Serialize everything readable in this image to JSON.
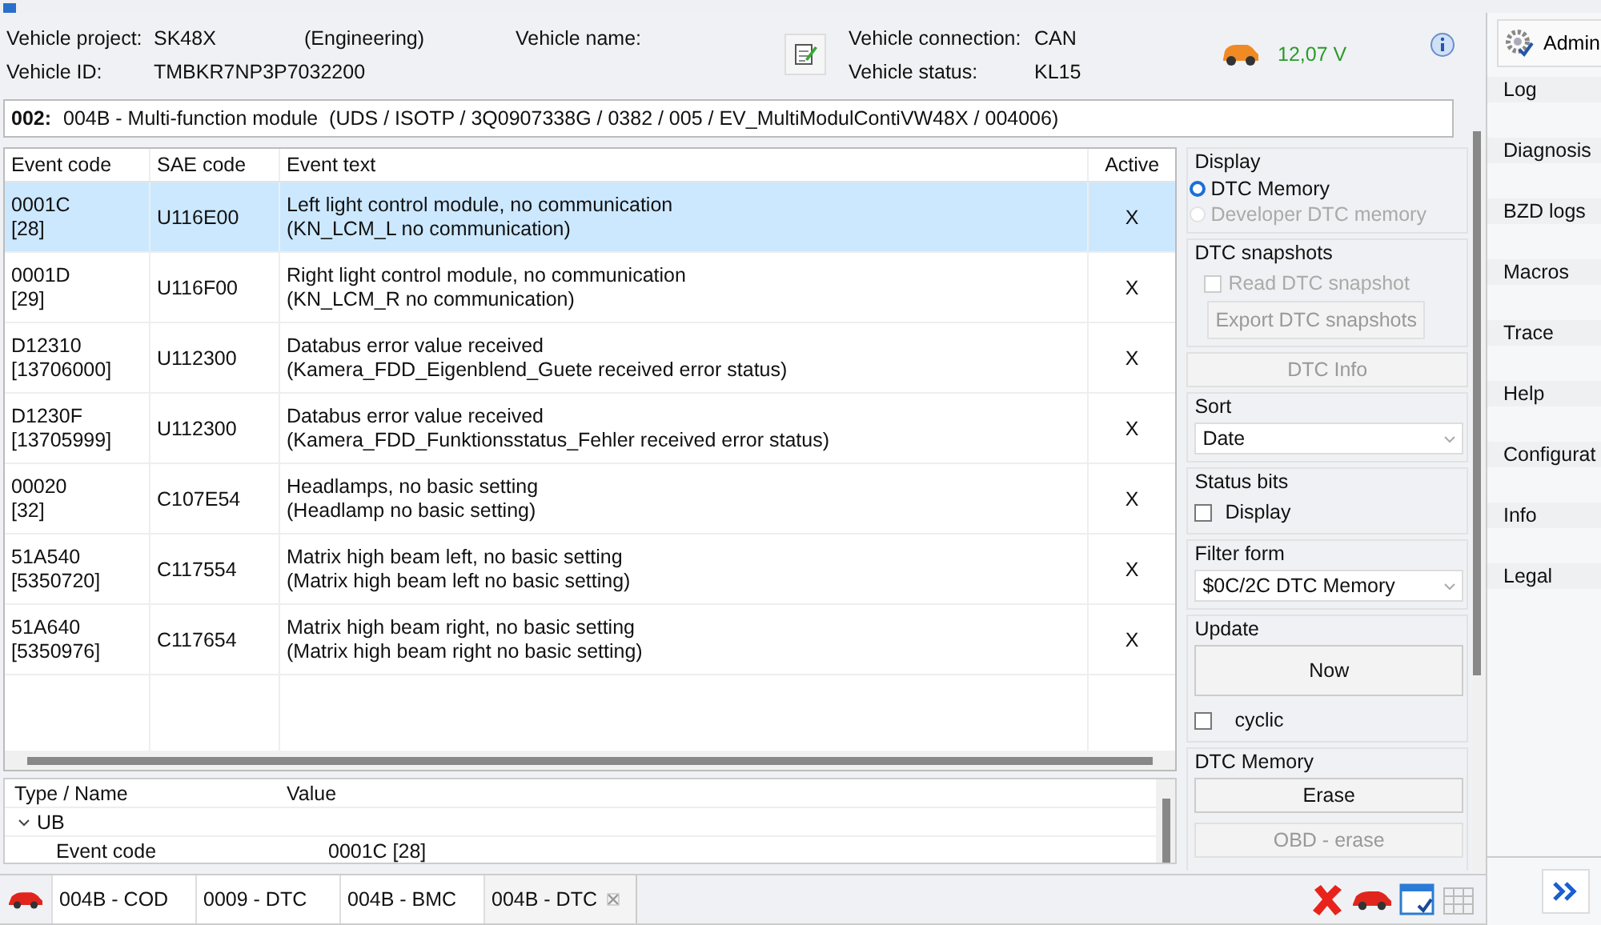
{
  "vehicle": {
    "project_label": "Vehicle project:",
    "project": "SK48X",
    "project_type": "(Engineering)",
    "name_label": "Vehicle name:",
    "id_label": "Vehicle ID:",
    "id": "TMBKR7NP3P7032200",
    "connection_label": "Vehicle connection:",
    "connection": "CAN",
    "status_label": "Vehicle status:",
    "status": "KL15",
    "voltage": "12,07 V"
  },
  "module": {
    "prefix": "002:",
    "text": "004B - Multi-function module  (UDS / ISOTP / 3Q0907338G / 0382 / 005 / EV_MultiModulContiVW48X / 004006)"
  },
  "table": {
    "columns": [
      "Event code",
      "SAE code",
      "Event text",
      "Active"
    ],
    "rows": [
      {
        "event_code": "0001C",
        "event_number": "[28]",
        "sae_code": "U116E00",
        "text": "Left light control module, no communication",
        "subtext": "(KN_LCM_L no communication)",
        "active": "X",
        "selected": true
      },
      {
        "event_code": "0001D",
        "event_number": "[29]",
        "sae_code": "U116F00",
        "text": "Right light control module, no communication",
        "subtext": "(KN_LCM_R no communication)",
        "active": "X",
        "selected": false
      },
      {
        "event_code": "D12310",
        "event_number": "[13706000]",
        "sae_code": "U112300",
        "text": "Databus error value received",
        "subtext": "(Kamera_FDD_Eigenblend_Guete received error status)",
        "active": "X",
        "selected": false
      },
      {
        "event_code": "D1230F",
        "event_number": "[13705999]",
        "sae_code": "U112300",
        "text": "Databus error value received",
        "subtext": "(Kamera_FDD_Funktionsstatus_Fehler received error status)",
        "active": "X",
        "selected": false
      },
      {
        "event_code": "00020",
        "event_number": "[32]",
        "sae_code": "C107E54",
        "text": "Headlamps, no basic setting",
        "subtext": "(Headlamp no basic setting)",
        "active": "X",
        "selected": false
      },
      {
        "event_code": "51A540",
        "event_number": "[5350720]",
        "sae_code": "C117554",
        "text": "Matrix high beam left, no basic setting",
        "subtext": "(Matrix high beam left no basic setting)",
        "active": "X",
        "selected": false
      },
      {
        "event_code": "51A640",
        "event_number": "[5350976]",
        "sae_code": "C117654",
        "text": "Matrix high beam right, no basic setting",
        "subtext": "(Matrix high beam right no basic setting)",
        "active": "X",
        "selected": false
      }
    ]
  },
  "details": {
    "columns": [
      "Type / Name",
      "Value"
    ],
    "rows": [
      {
        "name": "UB",
        "expanded": true,
        "children": [
          {
            "name": "Event code",
            "value": "0001C [28]"
          }
        ]
      }
    ]
  },
  "side_panel": {
    "display": {
      "title": "Display",
      "options": [
        {
          "label": "DTC Memory",
          "selected": true,
          "disabled": false
        },
        {
          "label": "Developer DTC memory",
          "selected": false,
          "disabled": true
        }
      ]
    },
    "snapshots": {
      "title": "DTC snapshots",
      "checkbox": {
        "label": "Read DTC snapshot",
        "checked": false,
        "disabled": true
      },
      "button": {
        "label": "Export DTC snapshots",
        "disabled": true
      }
    },
    "info_button": {
      "label": "DTC Info",
      "disabled": true
    },
    "sort": {
      "title": "Sort",
      "value": "Date"
    },
    "status_bits": {
      "title": "Status bits",
      "checkbox": {
        "label": "Display",
        "checked": false
      }
    },
    "filter_form": {
      "title": "Filter form",
      "value": "$0C/2C DTC Memory"
    },
    "update": {
      "title": "Update",
      "button": {
        "label": "Now",
        "disabled": false
      },
      "checkbox": {
        "label": "cyclic",
        "checked": false
      }
    },
    "dtc_memory": {
      "title": "DTC Memory",
      "buttons": [
        {
          "label": "Erase",
          "disabled": false
        },
        {
          "label": "OBD - erase",
          "disabled": true
        }
      ]
    }
  },
  "tabs": [
    {
      "label": "004B - COD",
      "selected": false
    },
    {
      "label": "0009 - DTC",
      "selected": false
    },
    {
      "label": "004B - BMC",
      "selected": false
    },
    {
      "label": "004B - DTC",
      "selected": true
    }
  ],
  "sidebar": {
    "admin": "Admin",
    "items": [
      "Log",
      "Diagnosis",
      "BZD logs",
      "Macros",
      "Trace",
      "Help",
      "Configurat",
      "Info",
      "Legal"
    ]
  }
}
